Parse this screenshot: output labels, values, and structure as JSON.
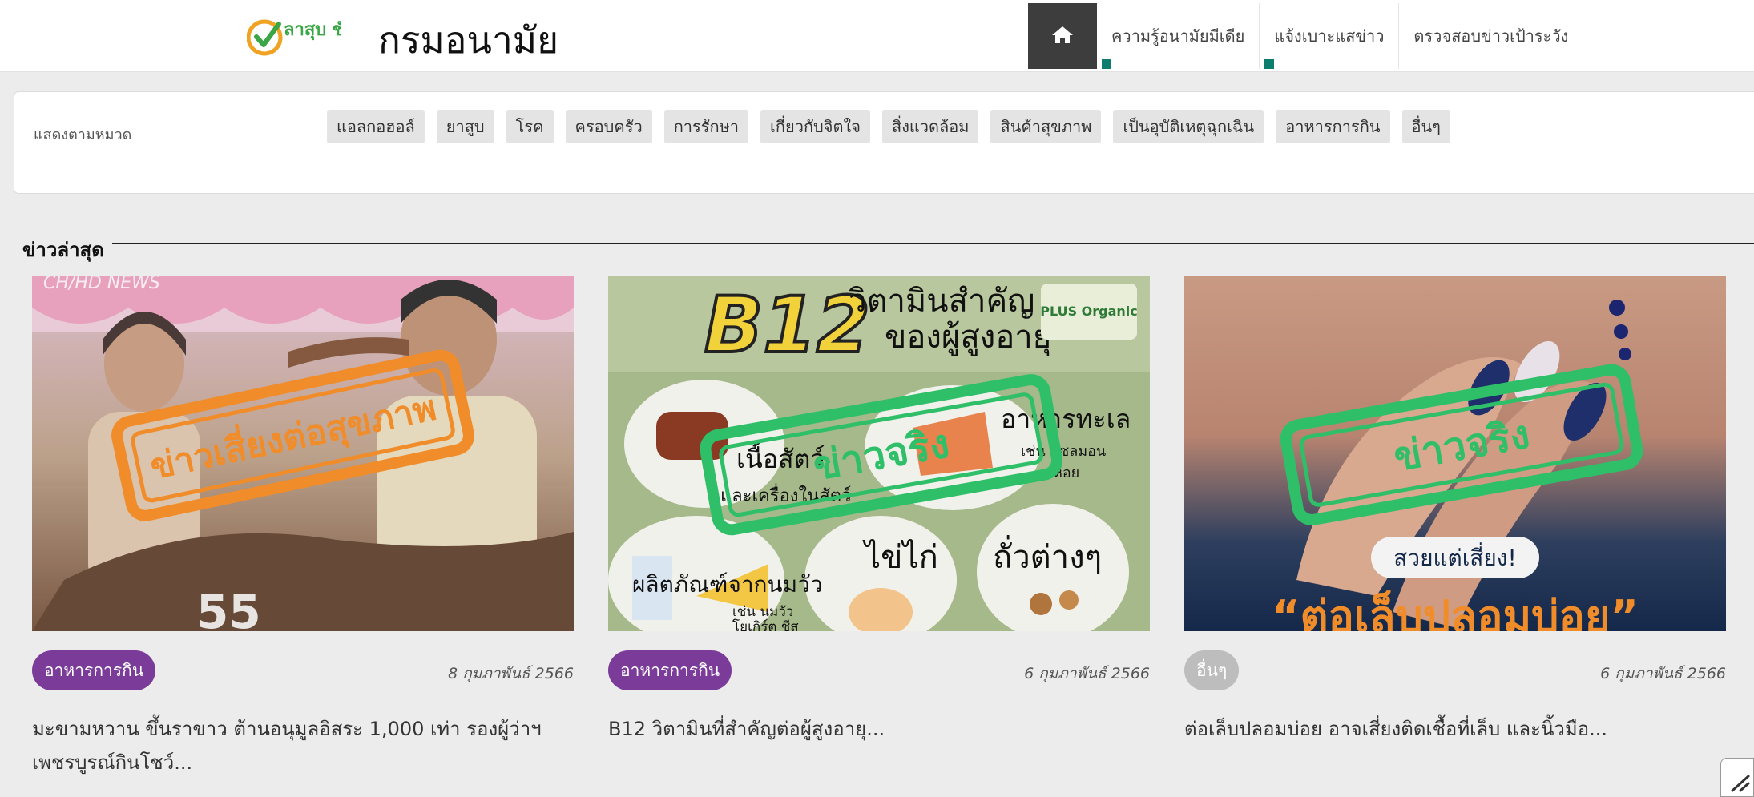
{
  "header": {
    "logo_text": "ลาสุบ ชัวร์",
    "site_title": "กรมอนามัย",
    "nav": [
      {
        "label": "ความรู้อนามัยมีเดีย"
      },
      {
        "label": "แจ้งเบาะแสข่าว"
      },
      {
        "label": "ตรวจสอบข่าวเป้าระวัง"
      }
    ]
  },
  "filter": {
    "label": "แสดงตามหมวด",
    "categories": [
      "แอลกอฮอล์",
      "ยาสูบ",
      "โรค",
      "ครอบครัว",
      "การรักษา",
      "เกี่ยวกับจิตใจ",
      "สิ่งแวดล้อม",
      "สินค้าสุขภาพ",
      "เป็นอุบัติเหตุฉุกเฉิน",
      "อาหารการกิน",
      "อื่นๆ"
    ]
  },
  "latest": {
    "title": "ข่าวล่าสุด",
    "cards": [
      {
        "image_overlay": {
          "watermark": "CH/HD NEWS",
          "stamp": "ข่าวเสี่ยงต่อสุขภาพ",
          "corner_number": "55"
        },
        "category": "อาหารการกิน",
        "category_color": "#7b3c99",
        "date": "8 กุมภาพันธ์ 2566",
        "title": "มะขามหวาน ขึ้นราขาว ต้านอนุมูลอิสระ 1,000 เท่า รองผู้ว่าฯ เพชรบูรณ์กินโชว์..."
      },
      {
        "image_overlay": {
          "headline_big": "B12",
          "headline_a": "วิตามินสำคัญ",
          "headline_b": "ของผู้สูงอายุ",
          "brand": "PLUS Organic",
          "stamp": "ข่าวจริง",
          "item1a": "เนื้อสัตว์",
          "item1b": "และเครื่องในสัตว์",
          "item2": "อาหารทะเล",
          "item2b": "เช่น แซลมอน",
          "item2c": "หอย",
          "item3": "ผลิตภัณฑ์จากนมวัว",
          "item3b": "เช่น นมวัว",
          "item3c": "โยเกิร์ต ชีส",
          "item4": "ไข่ไก่",
          "item5": "ถั่วต่างๆ"
        },
        "category": "อาหารการกิน",
        "category_color": "#7b3c99",
        "date": "6 กุมภาพันธ์ 2566",
        "title": "B12 วิตามินที่สำคัญต่อผู้สูงอายุ..."
      },
      {
        "image_overlay": {
          "stamp": "ข่าวจริง",
          "pill": "สวยแต่เสี่ยง!",
          "headline": "“ต่อเล็บปลอมบ่อย”"
        },
        "category": "อื่นๆ",
        "category_color": "#bdbdbd",
        "date": "6 กุมภาพันธ์ 2566",
        "title": "ต่อเล็บปลอมบ่อย อาจเสี่ยงติดเชื้อที่เล็บ และนิ้วมือ..."
      }
    ]
  }
}
